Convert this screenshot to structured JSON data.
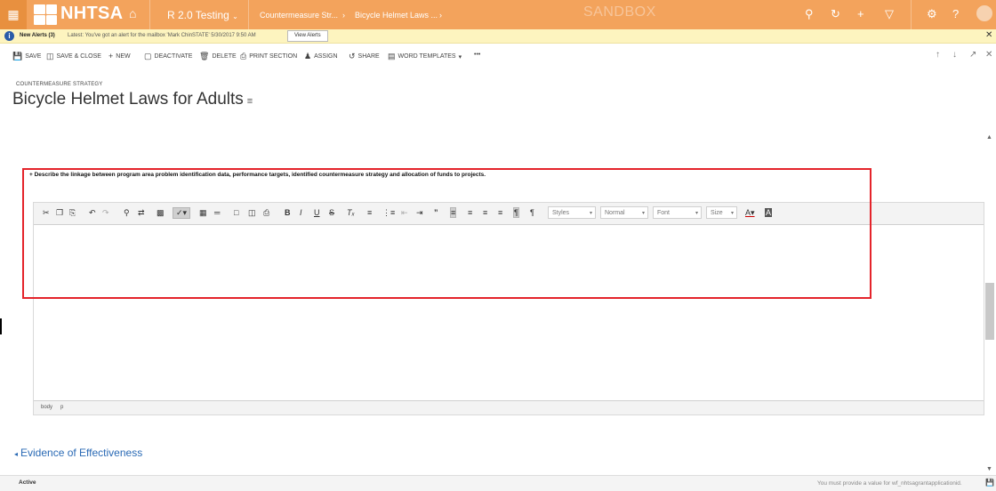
{
  "topnav": {
    "waffle_icon": "waffle-icon",
    "logo_text": "NHTSA",
    "app_name": "R 2.0 Testing",
    "breadcrumb_1": "Countermeasure Str...",
    "breadcrumb_2": "Bicycle Helmet Laws ...",
    "environment_label": "SANDBOX",
    "accent_color": "#f3a35c"
  },
  "alert": {
    "title": "New Alerts (3)",
    "message": "Latest: You've got an alert for the mailbox 'Mark ChinSTATE' 5/30/2017 9:50 AM",
    "button_label": "View Alerts",
    "close": "✕"
  },
  "commands": {
    "save": "SAVE",
    "save_close": "SAVE & CLOSE",
    "new": "NEW",
    "deactivate": "DEACTIVATE",
    "delete": "DELETE",
    "print_section": "PRINT SECTION",
    "assign": "ASSIGN",
    "share": "SHARE",
    "word_templates": "WORD TEMPLATES",
    "more": "•••"
  },
  "header": {
    "entity_type": "COUNTERMEASURE STRATEGY",
    "title": "Bicycle Helmet Laws for Adults"
  },
  "form": {
    "field_label": "Describe the linkage between program area problem identification data, performance targets, identified countermeasure strategy and allocation of funds to projects.",
    "required_marker": "+",
    "editor": {
      "styles": "Styles",
      "format": "Normal",
      "font": "Font",
      "size": "Size",
      "status_path_1": "body",
      "status_path_2": "p"
    },
    "section_title": "Evidence of Effectiveness"
  },
  "footer": {
    "status": "Active",
    "message": "You must provide a value for wf_nhtsagrantapplicationid."
  }
}
